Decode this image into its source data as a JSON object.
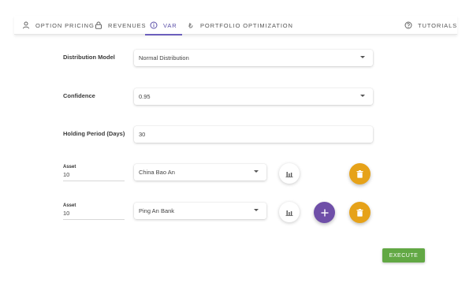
{
  "tabs": [
    {
      "label": "OPTION PRICING",
      "icon": "person-icon"
    },
    {
      "label": "REVENUES",
      "icon": "lock-icon"
    },
    {
      "label": "VAR",
      "icon": "info-icon",
      "active": true
    },
    {
      "label": "PORTFOLIO OPTIMIZATION",
      "icon": "currency-icon"
    }
  ],
  "tutorials": {
    "label": "TUTORIALS",
    "icon": "help-icon"
  },
  "form": {
    "distribution": {
      "label": "Distribution Model",
      "value": "Normal Distribution"
    },
    "confidence": {
      "label": "Confidence",
      "value": "0.95"
    },
    "holding": {
      "label": "Holding Period (Days)",
      "value": "30"
    }
  },
  "assets": [
    {
      "label": "Asset",
      "quantity": "10",
      "name": "China Bao An"
    },
    {
      "label": "Asset",
      "quantity": "10",
      "name": "Ping An Bank"
    }
  ],
  "execute_label": "EXECUTE",
  "colors": {
    "accent": "#6c5fbd",
    "add": "#6f4fa8",
    "delete": "#e6a219",
    "execute": "#62a844"
  }
}
